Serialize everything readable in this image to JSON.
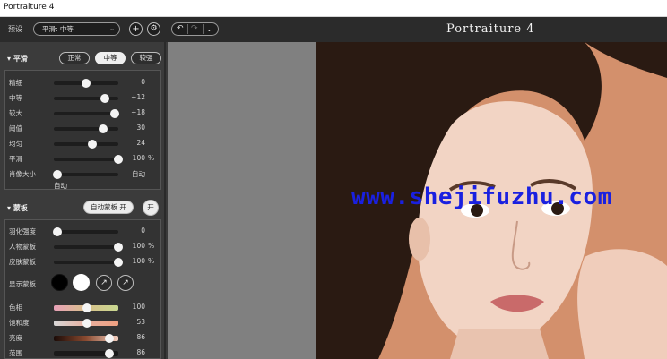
{
  "window": {
    "title": "Portraiture 4"
  },
  "toolbar": {
    "preset_label": "预设",
    "preset_value": "平滑: 中等",
    "add_button": "+",
    "settings_button": "⚙",
    "brand": "Portraiture 4"
  },
  "smooth": {
    "header": "平滑",
    "modes": [
      "正常",
      "中等",
      "较强"
    ],
    "active_mode": "中等",
    "sliders": [
      {
        "label": "精细",
        "value": "0",
        "level": 0.5
      },
      {
        "label": "中等",
        "value": "+12",
        "level": 0.79
      },
      {
        "label": "较大",
        "value": "+18",
        "level": 0.94
      },
      {
        "label": "阈值",
        "value": "30",
        "level": 0.76
      },
      {
        "label": "均匀",
        "value": "24",
        "level": 0.6
      },
      {
        "label": "平滑",
        "value": "100",
        "unit": "%",
        "level": 1.0
      },
      {
        "label": "肖像大小",
        "value": "自动",
        "level": 0.05
      }
    ],
    "auto_label": "自动"
  },
  "mask": {
    "header": "蒙板",
    "auto_mask_button": "自动蒙板 开",
    "toggle_button": "开",
    "sliders": [
      {
        "label": "羽化强度",
        "value": "0",
        "level": 0.05
      },
      {
        "label": "人物蒙板",
        "value": "100",
        "unit": "%",
        "level": 1.0
      },
      {
        "label": "皮肤蒙板",
        "value": "100",
        "unit": "%",
        "level": 1.0
      }
    ],
    "show_mask_label": "显示蒙板",
    "swatch_black": "#000000",
    "swatch_white": "#ffffff",
    "color_sliders": [
      {
        "label": "色相",
        "value": "100",
        "level": 0.52
      },
      {
        "label": "饱和度",
        "value": "53",
        "level": 0.52
      },
      {
        "label": "亮度",
        "value": "86",
        "level": 0.86
      },
      {
        "label": "范围",
        "value": "86",
        "level": 0.86
      }
    ]
  },
  "canvas": {
    "watermark": "www.shejifuzhu.com",
    "photo_background": "#d3906c"
  },
  "colors": {
    "panel": "#3b3b3b",
    "toolbar": "#2b2b2b",
    "canvas_gray": "#808080",
    "watermark": "#1a20e0"
  }
}
